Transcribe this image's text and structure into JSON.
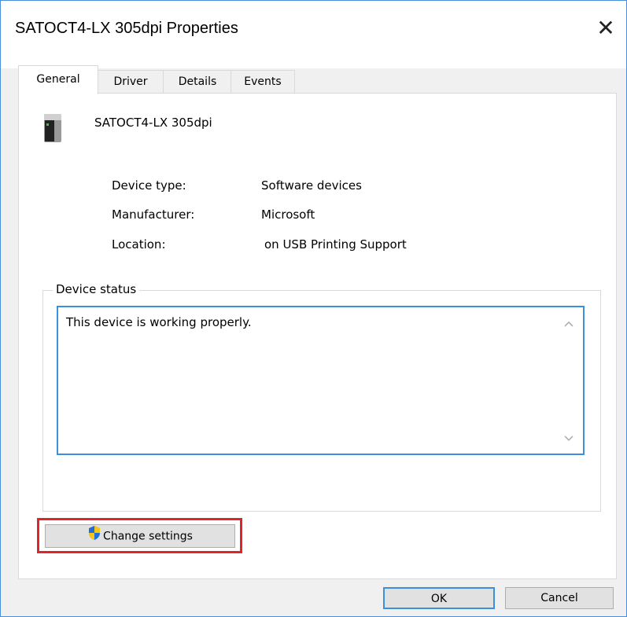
{
  "window": {
    "title": "SATOCT4-LX 305dpi  Properties",
    "close_glyph": "✕"
  },
  "tabs": [
    {
      "label": "General",
      "active": true
    },
    {
      "label": "Driver",
      "active": false
    },
    {
      "label": "Details",
      "active": false
    },
    {
      "label": "Events",
      "active": false
    }
  ],
  "general": {
    "device_icon": "printer-device-icon",
    "device_name": "SATOCT4-LX 305dpi",
    "properties": [
      {
        "label": "Device type:",
        "value": "Software devices"
      },
      {
        "label": "Manufacturer:",
        "value": "Microsoft"
      },
      {
        "label": "Location:",
        "value": "on USB Printing Support"
      }
    ],
    "status_group_label": "Device status",
    "status_text": "This device is working properly.",
    "change_settings_label": "Change settings"
  },
  "buttons": {
    "ok_label": "OK",
    "cancel_label": "Cancel"
  },
  "colors": {
    "accent_border": "#3d8fdc",
    "highlight": "#e1232b"
  }
}
